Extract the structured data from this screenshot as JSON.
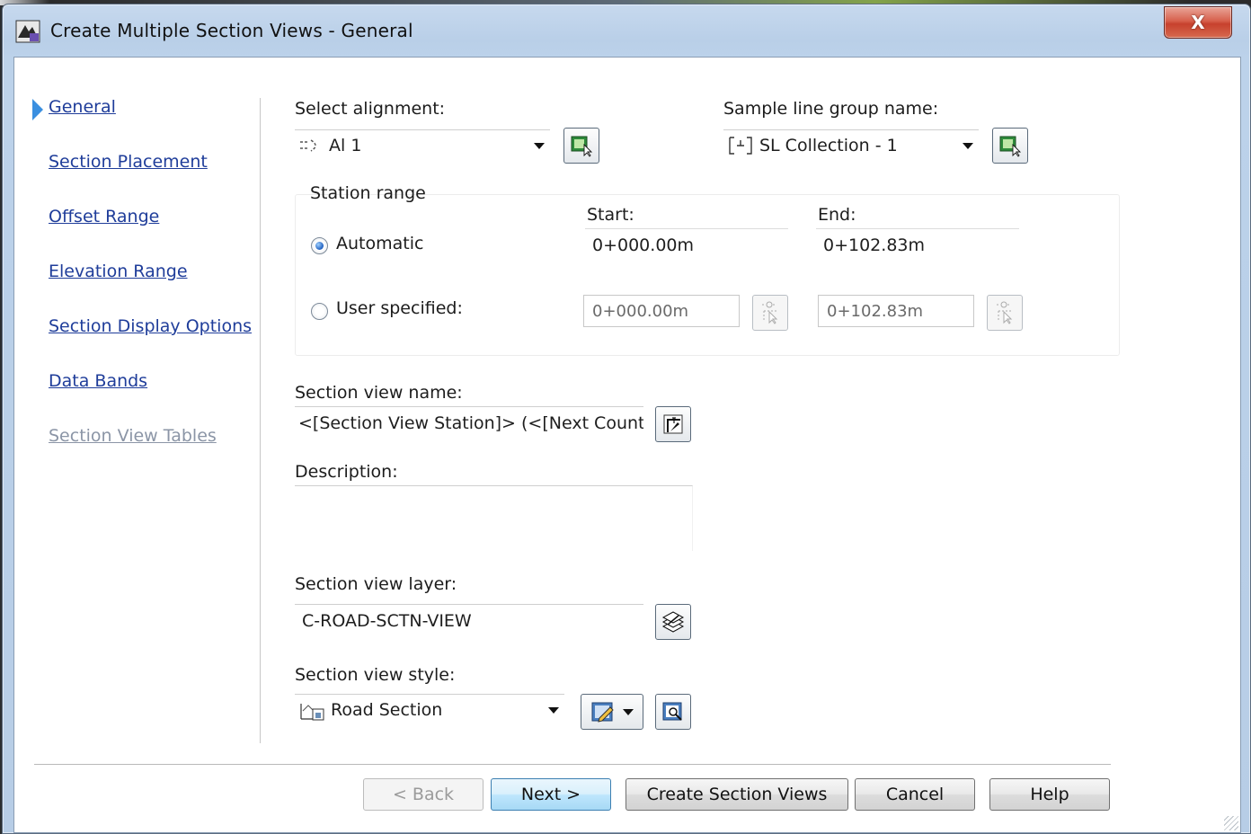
{
  "window": {
    "title": "Create Multiple Section Views - General",
    "close_glyph": "X",
    "app_icon": "civil3d-app-icon"
  },
  "nav": {
    "items": [
      {
        "label": "General",
        "active": true
      },
      {
        "label": "Section Placement"
      },
      {
        "label": "Offset Range"
      },
      {
        "label": "Elevation Range"
      },
      {
        "label": "Section Display Options"
      },
      {
        "label": "Data Bands"
      },
      {
        "label": "Section View Tables",
        "disabled": true
      }
    ]
  },
  "general": {
    "alignment_label": "Select alignment:",
    "alignment_value": "Al 1",
    "sample_group_label": "Sample line group name:",
    "sample_group_value": "SL Collection - 1",
    "station_range": {
      "title": "Station range",
      "start_label": "Start:",
      "end_label": "End:",
      "automatic_label": "Automatic",
      "automatic_selected": true,
      "auto_start": "0+000.00m",
      "auto_end": "0+102.83m",
      "user_label": "User specified:",
      "user_start": "0+000.00m",
      "user_end": "0+102.83m"
    },
    "view_name_label": "Section view name:",
    "view_name_value": "<[Section View Station]> (<[Next Counter(C",
    "description_label": "Description:",
    "description_value": "",
    "layer_label": "Section view layer:",
    "layer_value": "C-ROAD-SCTN-VIEW",
    "style_label": "Section view style:",
    "style_value": "Road Section"
  },
  "buttons": {
    "back": "< Back",
    "next": "Next >",
    "create": "Create Section Views",
    "cancel": "Cancel",
    "help": "Help"
  },
  "colors": {
    "link": "#1f3d9a",
    "nav_arrow": "#3a8fe0",
    "close_red": "#c7412d"
  }
}
